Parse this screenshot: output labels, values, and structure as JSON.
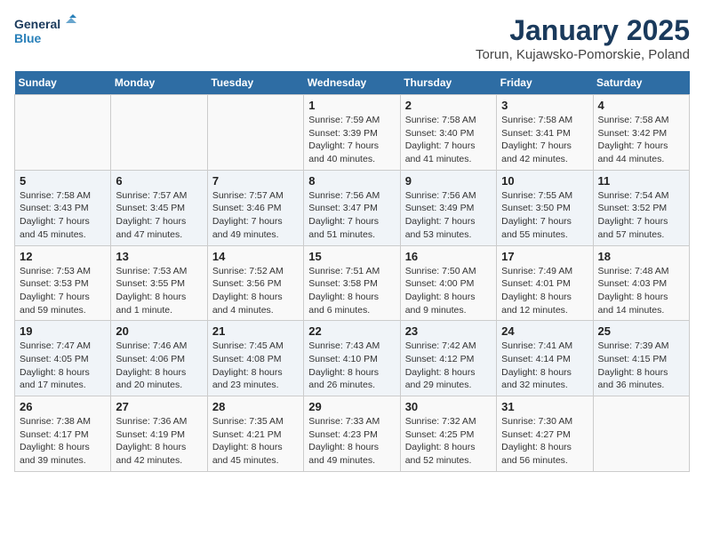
{
  "header": {
    "logo_line1": "General",
    "logo_line2": "Blue",
    "title": "January 2025",
    "subtitle": "Torun, Kujawsko-Pomorskie, Poland"
  },
  "weekdays": [
    "Sunday",
    "Monday",
    "Tuesday",
    "Wednesday",
    "Thursday",
    "Friday",
    "Saturday"
  ],
  "weeks": [
    [
      {
        "day": "",
        "info": ""
      },
      {
        "day": "",
        "info": ""
      },
      {
        "day": "",
        "info": ""
      },
      {
        "day": "1",
        "info": "Sunrise: 7:59 AM\nSunset: 3:39 PM\nDaylight: 7 hours\nand 40 minutes."
      },
      {
        "day": "2",
        "info": "Sunrise: 7:58 AM\nSunset: 3:40 PM\nDaylight: 7 hours\nand 41 minutes."
      },
      {
        "day": "3",
        "info": "Sunrise: 7:58 AM\nSunset: 3:41 PM\nDaylight: 7 hours\nand 42 minutes."
      },
      {
        "day": "4",
        "info": "Sunrise: 7:58 AM\nSunset: 3:42 PM\nDaylight: 7 hours\nand 44 minutes."
      }
    ],
    [
      {
        "day": "5",
        "info": "Sunrise: 7:58 AM\nSunset: 3:43 PM\nDaylight: 7 hours\nand 45 minutes."
      },
      {
        "day": "6",
        "info": "Sunrise: 7:57 AM\nSunset: 3:45 PM\nDaylight: 7 hours\nand 47 minutes."
      },
      {
        "day": "7",
        "info": "Sunrise: 7:57 AM\nSunset: 3:46 PM\nDaylight: 7 hours\nand 49 minutes."
      },
      {
        "day": "8",
        "info": "Sunrise: 7:56 AM\nSunset: 3:47 PM\nDaylight: 7 hours\nand 51 minutes."
      },
      {
        "day": "9",
        "info": "Sunrise: 7:56 AM\nSunset: 3:49 PM\nDaylight: 7 hours\nand 53 minutes."
      },
      {
        "day": "10",
        "info": "Sunrise: 7:55 AM\nSunset: 3:50 PM\nDaylight: 7 hours\nand 55 minutes."
      },
      {
        "day": "11",
        "info": "Sunrise: 7:54 AM\nSunset: 3:52 PM\nDaylight: 7 hours\nand 57 minutes."
      }
    ],
    [
      {
        "day": "12",
        "info": "Sunrise: 7:53 AM\nSunset: 3:53 PM\nDaylight: 7 hours\nand 59 minutes."
      },
      {
        "day": "13",
        "info": "Sunrise: 7:53 AM\nSunset: 3:55 PM\nDaylight: 8 hours\nand 1 minute."
      },
      {
        "day": "14",
        "info": "Sunrise: 7:52 AM\nSunset: 3:56 PM\nDaylight: 8 hours\nand 4 minutes."
      },
      {
        "day": "15",
        "info": "Sunrise: 7:51 AM\nSunset: 3:58 PM\nDaylight: 8 hours\nand 6 minutes."
      },
      {
        "day": "16",
        "info": "Sunrise: 7:50 AM\nSunset: 4:00 PM\nDaylight: 8 hours\nand 9 minutes."
      },
      {
        "day": "17",
        "info": "Sunrise: 7:49 AM\nSunset: 4:01 PM\nDaylight: 8 hours\nand 12 minutes."
      },
      {
        "day": "18",
        "info": "Sunrise: 7:48 AM\nSunset: 4:03 PM\nDaylight: 8 hours\nand 14 minutes."
      }
    ],
    [
      {
        "day": "19",
        "info": "Sunrise: 7:47 AM\nSunset: 4:05 PM\nDaylight: 8 hours\nand 17 minutes."
      },
      {
        "day": "20",
        "info": "Sunrise: 7:46 AM\nSunset: 4:06 PM\nDaylight: 8 hours\nand 20 minutes."
      },
      {
        "day": "21",
        "info": "Sunrise: 7:45 AM\nSunset: 4:08 PM\nDaylight: 8 hours\nand 23 minutes."
      },
      {
        "day": "22",
        "info": "Sunrise: 7:43 AM\nSunset: 4:10 PM\nDaylight: 8 hours\nand 26 minutes."
      },
      {
        "day": "23",
        "info": "Sunrise: 7:42 AM\nSunset: 4:12 PM\nDaylight: 8 hours\nand 29 minutes."
      },
      {
        "day": "24",
        "info": "Sunrise: 7:41 AM\nSunset: 4:14 PM\nDaylight: 8 hours\nand 32 minutes."
      },
      {
        "day": "25",
        "info": "Sunrise: 7:39 AM\nSunset: 4:15 PM\nDaylight: 8 hours\nand 36 minutes."
      }
    ],
    [
      {
        "day": "26",
        "info": "Sunrise: 7:38 AM\nSunset: 4:17 PM\nDaylight: 8 hours\nand 39 minutes."
      },
      {
        "day": "27",
        "info": "Sunrise: 7:36 AM\nSunset: 4:19 PM\nDaylight: 8 hours\nand 42 minutes."
      },
      {
        "day": "28",
        "info": "Sunrise: 7:35 AM\nSunset: 4:21 PM\nDaylight: 8 hours\nand 45 minutes."
      },
      {
        "day": "29",
        "info": "Sunrise: 7:33 AM\nSunset: 4:23 PM\nDaylight: 8 hours\nand 49 minutes."
      },
      {
        "day": "30",
        "info": "Sunrise: 7:32 AM\nSunset: 4:25 PM\nDaylight: 8 hours\nand 52 minutes."
      },
      {
        "day": "31",
        "info": "Sunrise: 7:30 AM\nSunset: 4:27 PM\nDaylight: 8 hours\nand 56 minutes."
      },
      {
        "day": "",
        "info": ""
      }
    ]
  ]
}
